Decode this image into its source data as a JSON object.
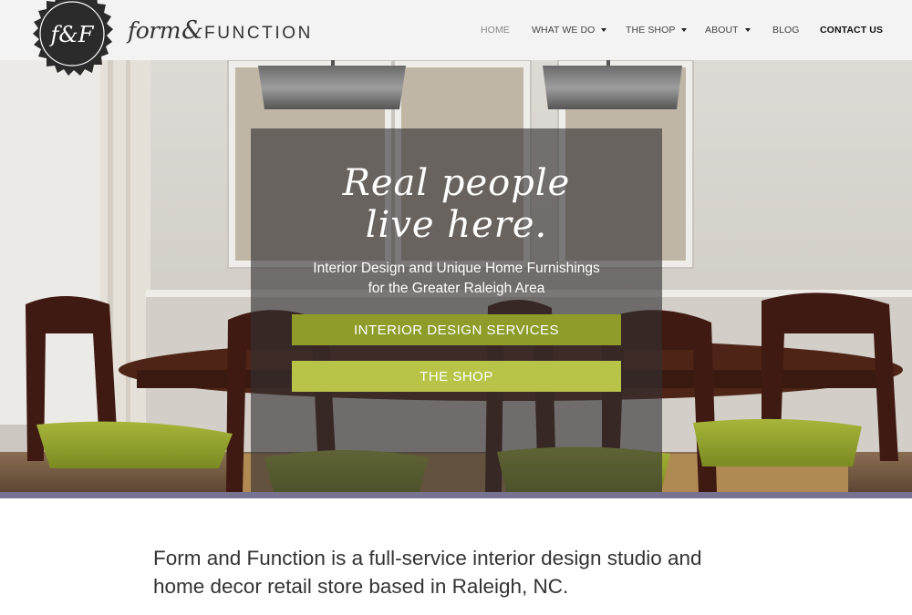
{
  "brand": {
    "seal_letters": "f&F",
    "wordmark_script": "form",
    "wordmark_amp": "&",
    "wordmark_caps": "FUNCTION",
    "seal_color": "#2b2b2b"
  },
  "nav": {
    "items": [
      {
        "label": "HOME",
        "has_dropdown": false,
        "state": "active"
      },
      {
        "label": "WHAT WE DO",
        "has_dropdown": true
      },
      {
        "label": "THE SHOP",
        "has_dropdown": true
      },
      {
        "label": "ABOUT",
        "has_dropdown": true
      },
      {
        "label": "BLOG",
        "has_dropdown": false
      },
      {
        "label": "CONTACT US",
        "has_dropdown": false,
        "emphasis": "bold"
      }
    ]
  },
  "hero": {
    "headline_line1": "Real people",
    "headline_line2": "live here.",
    "subhead_line1": "Interior Design and Unique Home Furnishings",
    "subhead_line2": "for the Greater Raleigh Area",
    "primary_button": "INTERIOR DESIGN SERVICES",
    "secondary_button": "THE SHOP",
    "primary_color": "#8f9c2a",
    "secondary_color": "#b7c447",
    "band_color": "#77728f"
  },
  "intro": {
    "line1": "Form and Function is a full-service interior design studio and",
    "line2": "home decor retail store based in Raleigh, NC."
  }
}
